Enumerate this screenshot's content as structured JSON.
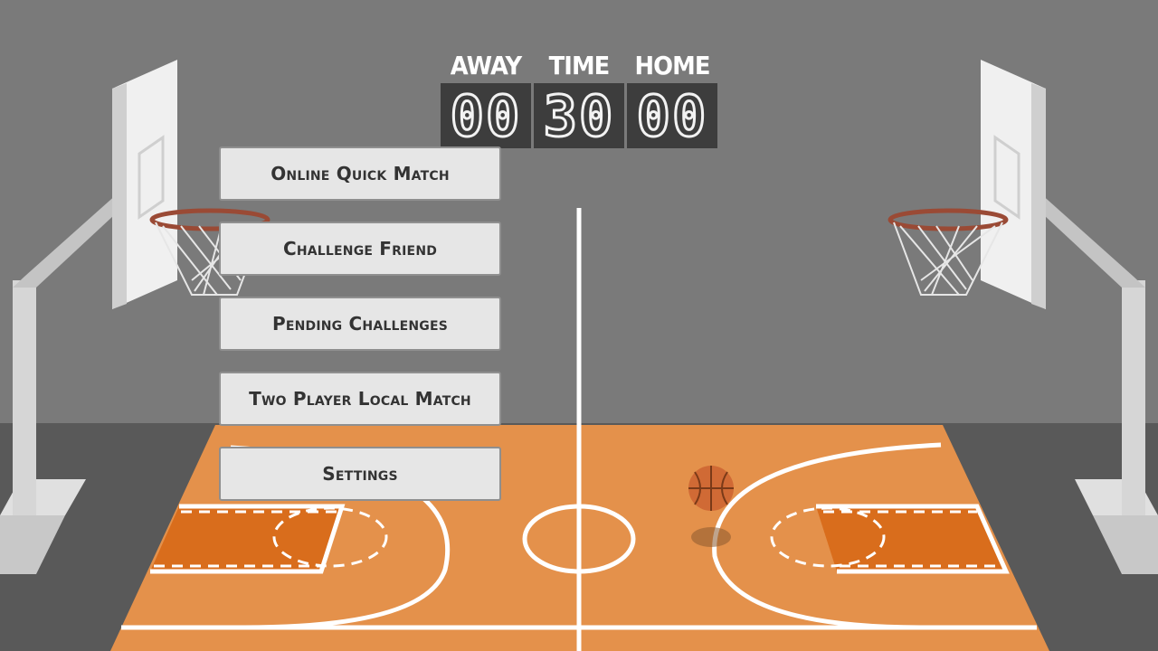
{
  "scoreboard": {
    "away": {
      "label": "AWAY",
      "value": "00"
    },
    "time": {
      "label": "TIME",
      "value": "30"
    },
    "home": {
      "label": "HOME",
      "value": "00"
    }
  },
  "menu": {
    "items": [
      {
        "label": "Online Quick Match"
      },
      {
        "label": "Challenge Friend"
      },
      {
        "label": "Pending Challenges"
      },
      {
        "label": "Two Player Local Match"
      },
      {
        "label": "Settings"
      }
    ]
  },
  "colors": {
    "wall": "#7a7a7a",
    "floor_surround": "#595959",
    "court": "#e4914b",
    "paint": "#d96d1c",
    "lines": "#ffffff",
    "scoreboard": "#3d3d3d",
    "button": "#e6e6e6",
    "button_text": "#333333"
  }
}
